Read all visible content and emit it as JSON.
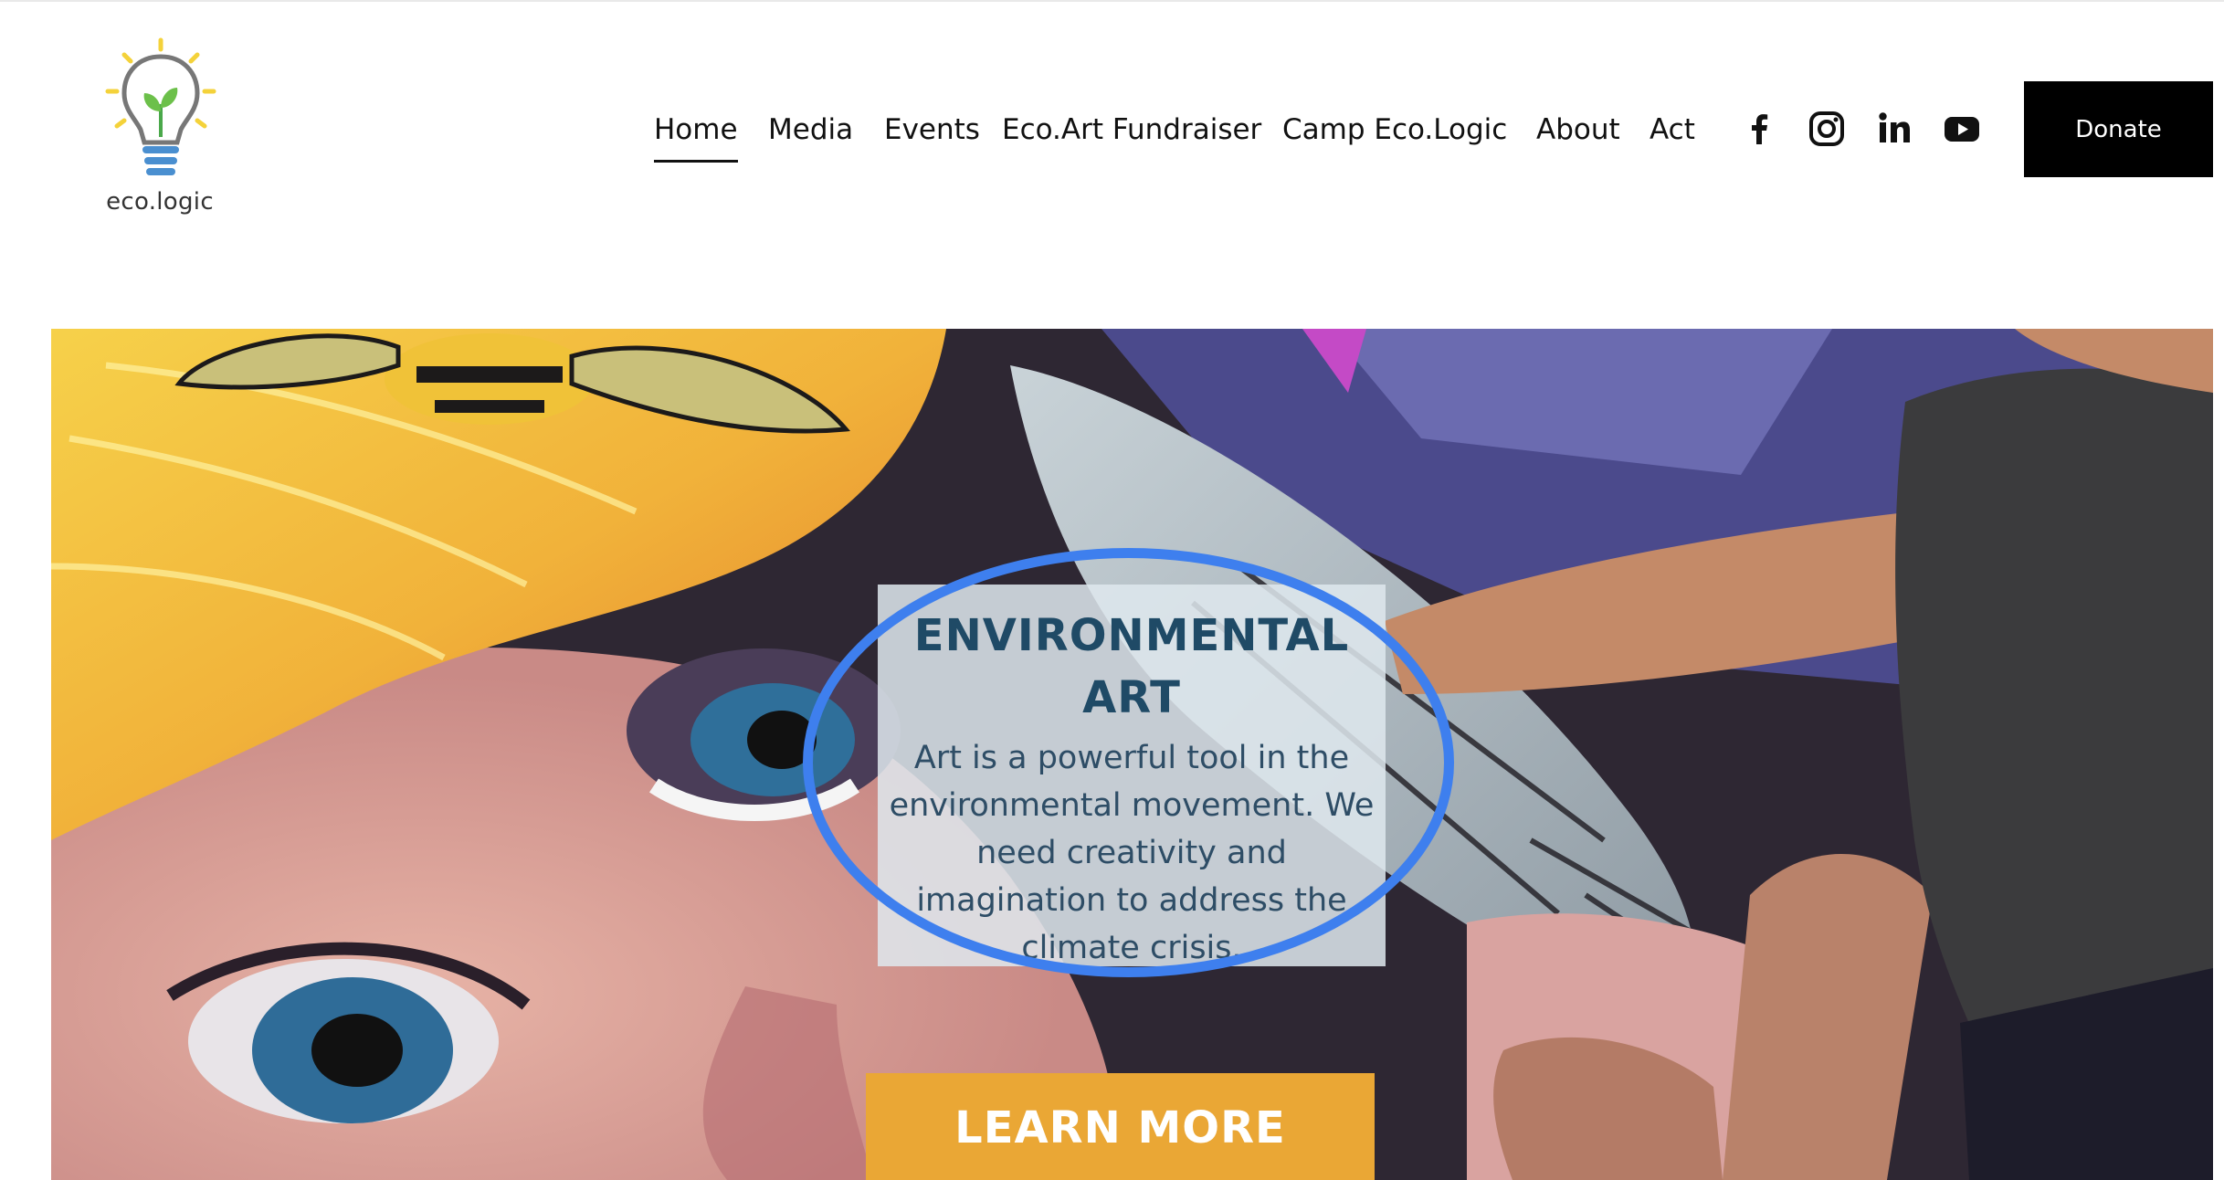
{
  "brand": {
    "name": "eco.logic",
    "logo_icon": "lightbulb-sprout-icon"
  },
  "nav": {
    "items": [
      "Home",
      "Media",
      "Events",
      "Eco.Art Fundraiser",
      "Camp Eco.Logic",
      "About",
      "Act"
    ],
    "active": "Home"
  },
  "social": [
    "facebook-icon",
    "instagram-icon",
    "linkedin-icon",
    "youtube-icon"
  ],
  "donate": {
    "label": "Donate"
  },
  "hero": {
    "title": "ENVIRONMENTAL ART",
    "text": "Art is a powerful tool in the environmental movement. We need creativity and imagination to address the climate crisis.",
    "button_label": "LEARN MORE"
  },
  "colors": {
    "accent": "#eaa735",
    "title": "#1f4a66",
    "highlight": "#3e7fee",
    "donate_bg": "#000000"
  }
}
